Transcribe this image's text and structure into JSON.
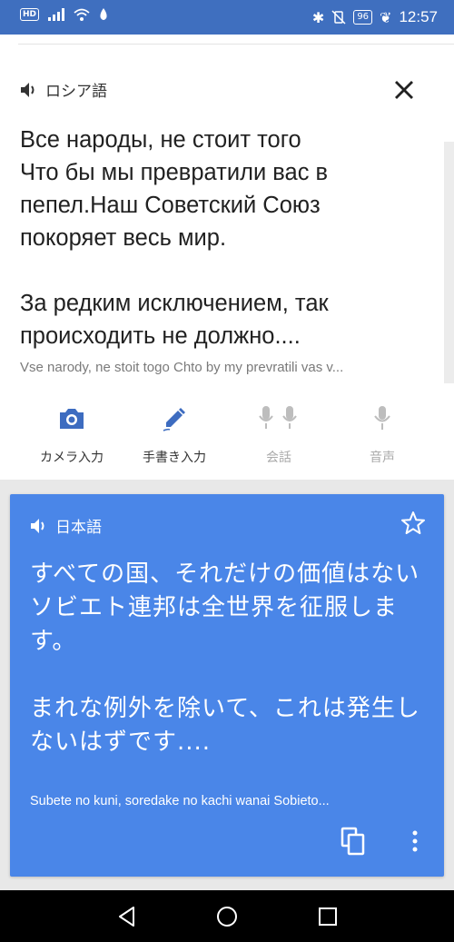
{
  "status_bar": {
    "hd_badge": "HD",
    "battery": "96",
    "time": "12:57"
  },
  "source": {
    "language": "ロシア語",
    "text": "Все народы, не стоит того\nЧто бы мы превратили вас в\nпепел.Наш Советский Союз\nпокоряет весь мир.\n\nЗа редким исключением, так\nпроисходить не должно....",
    "romanization": "Vse narody, ne stoit togo Chto by my prevratili vas v...",
    "icons": {
      "speaker": "speaker-icon",
      "close": "close-icon"
    }
  },
  "tools": [
    {
      "label": "カメラ入力",
      "icon": "camera-icon",
      "enabled": true
    },
    {
      "label": "手書き入力",
      "icon": "pen-icon",
      "enabled": true
    },
    {
      "label": "会話",
      "icon": "conversation-mic-icon",
      "enabled": false
    },
    {
      "label": "音声",
      "icon": "mic-icon",
      "enabled": false
    }
  ],
  "result": {
    "language": "日本語",
    "text": "すべての国、それだけの価値はない\n ソビエト連邦は全世界を征服します。\n\n まれな例外を除いて、これは発生しないはずです....",
    "romanization": "Subete no kuni, soredake no kachi wanai Sobieto...",
    "icons": {
      "star": "star-icon",
      "copy": "copy-icon",
      "more": "more-vert-icon"
    }
  },
  "colors": {
    "status_bar": "#3f6fbf",
    "result_card": "#4a86e8",
    "tool_active": "#3d6cc0",
    "tool_disabled": "#bdbdbd"
  }
}
